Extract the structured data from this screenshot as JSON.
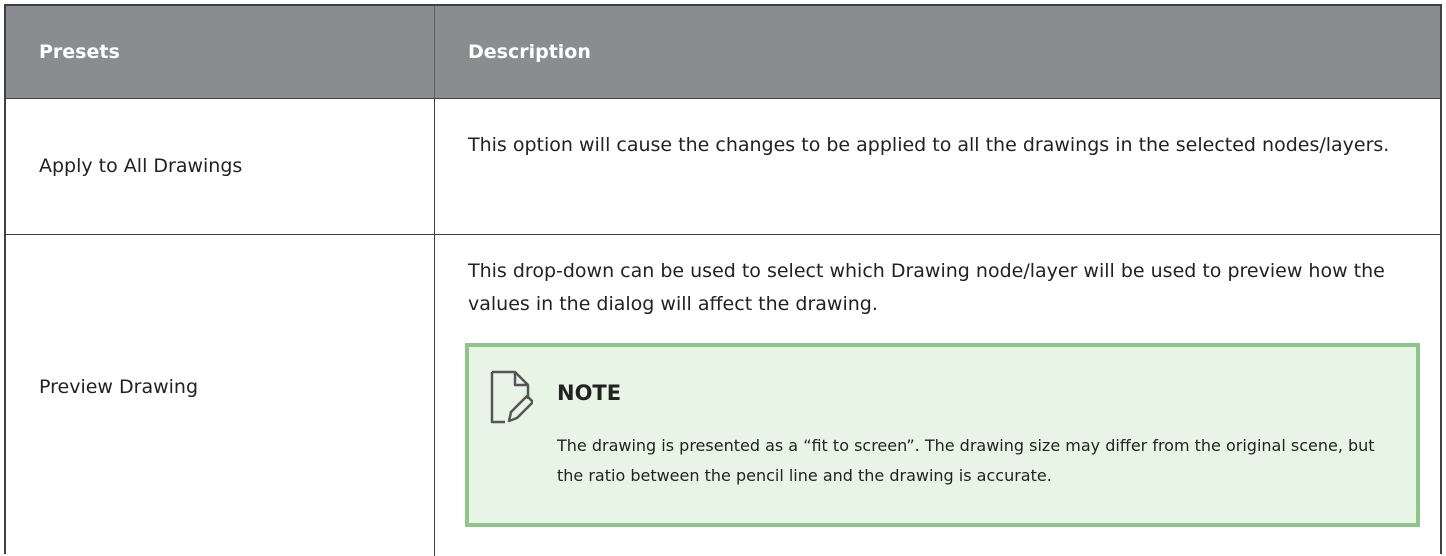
{
  "table": {
    "headers": {
      "presets": "Presets",
      "description": "Description"
    },
    "rows": [
      {
        "preset": "Apply to All Drawings",
        "description": "This option will cause the changes to be applied to all the drawings in the selected nodes/layers."
      },
      {
        "preset": "Preview Drawing",
        "description": "This drop-down can be used to select which Drawing node/layer will be used to preview how the values in the dialog will affect the drawing.",
        "note": {
          "icon": "note-edit-icon",
          "title": "NOTE",
          "text": "The drawing is presented as a “fit to screen”. The drawing size may differ from the original scene, but the ratio between the pencil line and the drawing is accurate."
        }
      }
    ]
  },
  "colors": {
    "header_bg": "#8a8c8f",
    "note_bg": "#e8f5e6",
    "note_border": "#8fc48a"
  }
}
